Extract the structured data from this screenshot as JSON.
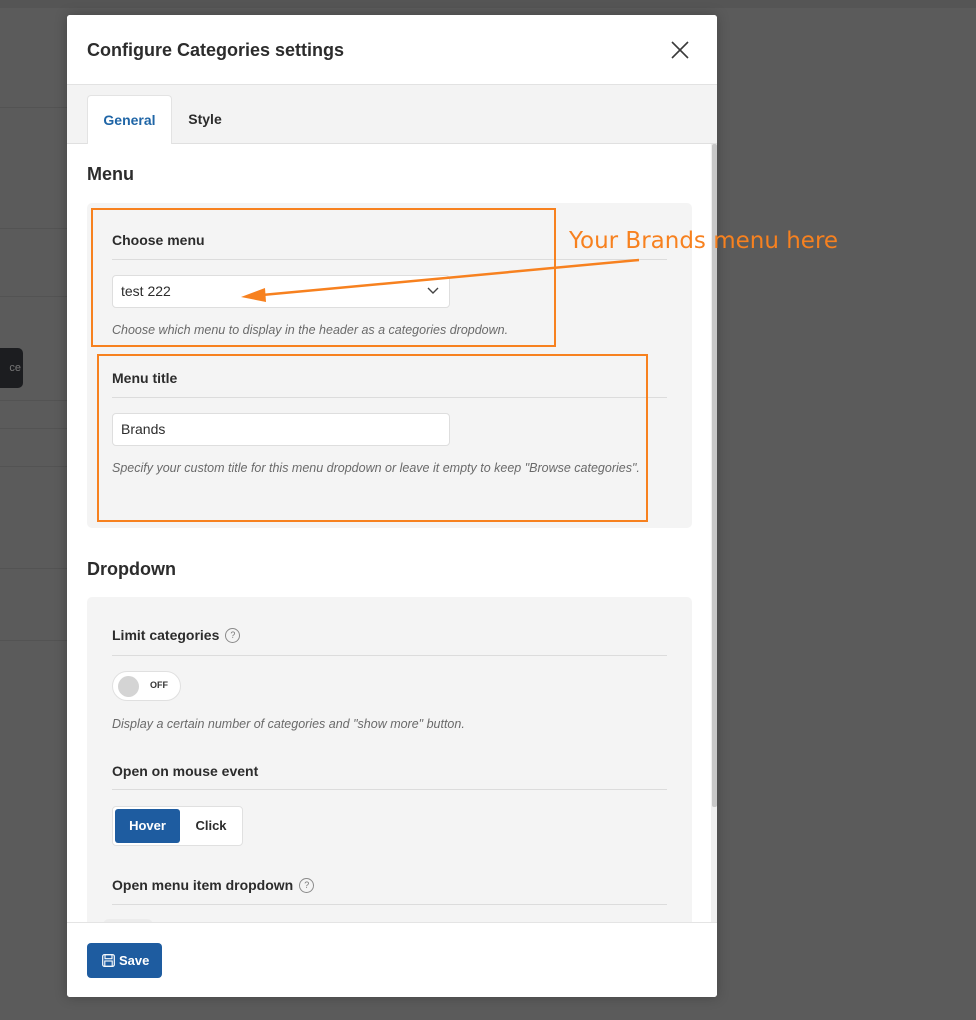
{
  "background": {
    "chip_text": "ce"
  },
  "modal": {
    "title": "Configure Categories settings",
    "close_icon": "close-icon",
    "tabs": [
      {
        "label": "General",
        "active": true
      },
      {
        "label": "Style",
        "active": false
      }
    ],
    "sections": {
      "menu": {
        "title": "Menu",
        "choose_menu": {
          "label": "Choose menu",
          "selected_value": "test 222",
          "hint": "Choose which menu to display in the header as a categories dropdown."
        },
        "menu_title": {
          "label": "Menu title",
          "value": "Brands",
          "hint": "Specify your custom title for this menu dropdown or leave it empty to keep \"Browse categories\"."
        }
      },
      "dropdown": {
        "title": "Dropdown",
        "limit_categories": {
          "label": "Limit categories",
          "help_icon": "?",
          "toggle_state": "OFF",
          "hint": "Display a certain number of categories and \"show more\" button."
        },
        "open_on_mouse_event": {
          "label": "Open on mouse event",
          "options": [
            "Hover",
            "Click"
          ],
          "selected": "Hover"
        },
        "open_menu_item_dropdown": {
          "label": "Open menu item dropdown",
          "help_icon": "?"
        }
      }
    },
    "footer": {
      "save_label": "Save",
      "save_icon": "floppy-disk-icon"
    }
  },
  "annotation": {
    "text": "Your Brands menu here",
    "color": "#f7811f"
  },
  "colors": {
    "accent": "#1e5ca0",
    "tab_active_text": "#1f65a6",
    "annotation": "#f7811f"
  }
}
